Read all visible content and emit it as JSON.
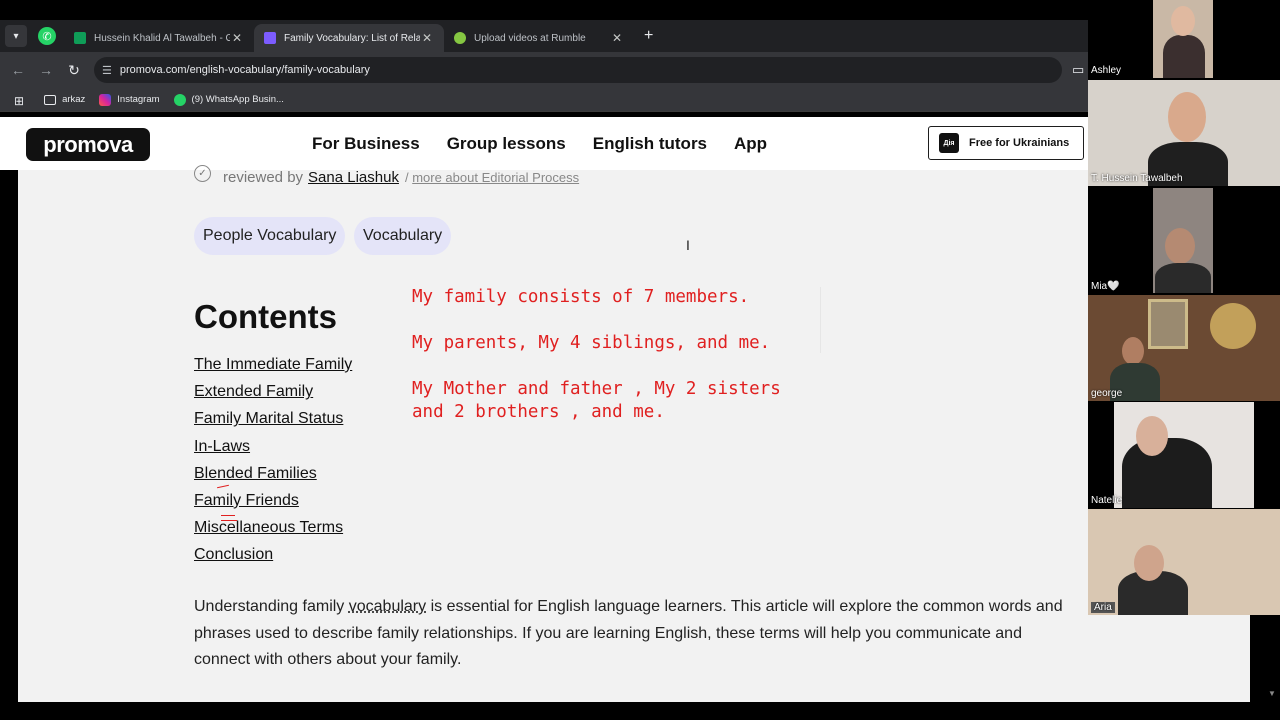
{
  "browser": {
    "tabs": [
      {
        "title": "Hussein Khalid Al Tawalbeh - Go",
        "active": false,
        "favicon_color": "#0f9d58"
      },
      {
        "title": "Family Vocabulary: List of Relati",
        "active": true,
        "favicon_color": "#7c5cff"
      },
      {
        "title": "Upload videos at Rumble",
        "active": false,
        "favicon_color": "#85c742"
      }
    ],
    "new_tab": "+",
    "url": "promova.com/english-vocabulary/family-vocabulary",
    "bookmarks": [
      {
        "label": "arkaz",
        "icon": "folder-icon"
      },
      {
        "label": "Instagram",
        "icon": "instagram-icon"
      },
      {
        "label": "(9) WhatsApp Busin...",
        "icon": "whatsapp-icon"
      }
    ]
  },
  "site": {
    "logo": "promova",
    "nav": [
      "For Business",
      "Group lessons",
      "English tutors",
      "App"
    ],
    "cta_badge": "Дія",
    "cta": "Free for Ukrainians"
  },
  "article": {
    "reviewed_prefix": "reviewed by",
    "reviewer": "Sana Liashuk",
    "separator": "/",
    "editorial_link": "more about Editorial Process",
    "tags": [
      "People Vocabulary",
      "Vocabulary"
    ],
    "contents_title": "Contents",
    "toc": [
      "The Immediate Family",
      "Extended Family",
      "Family Marital Status",
      "In-Laws",
      "Blended Families",
      "Family Friends",
      "Miscellaneous Terms",
      "Conclusion"
    ],
    "intro_part1": "Understanding family ",
    "intro_link": "vocabulary",
    "intro_part2": " is essential for English language learners. This article will explore the common words and phrases used to describe family relationships. If you are learning English, these terms will help you communicate and connect with others about your family."
  },
  "annotations": {
    "color": "#e02020",
    "lines": [
      "My family consists of 7 members.",
      "My parents, My 4 siblings, and me.",
      "My Mother and father , My 2 sisters and 2 brothers , and me."
    ]
  },
  "participants": [
    {
      "name": "Ashley"
    },
    {
      "name": "T. Hussein Tawalbeh"
    },
    {
      "name": "Mia🤍"
    },
    {
      "name": "george"
    },
    {
      "name": "Natelie"
    },
    {
      "name": "Aria"
    }
  ]
}
